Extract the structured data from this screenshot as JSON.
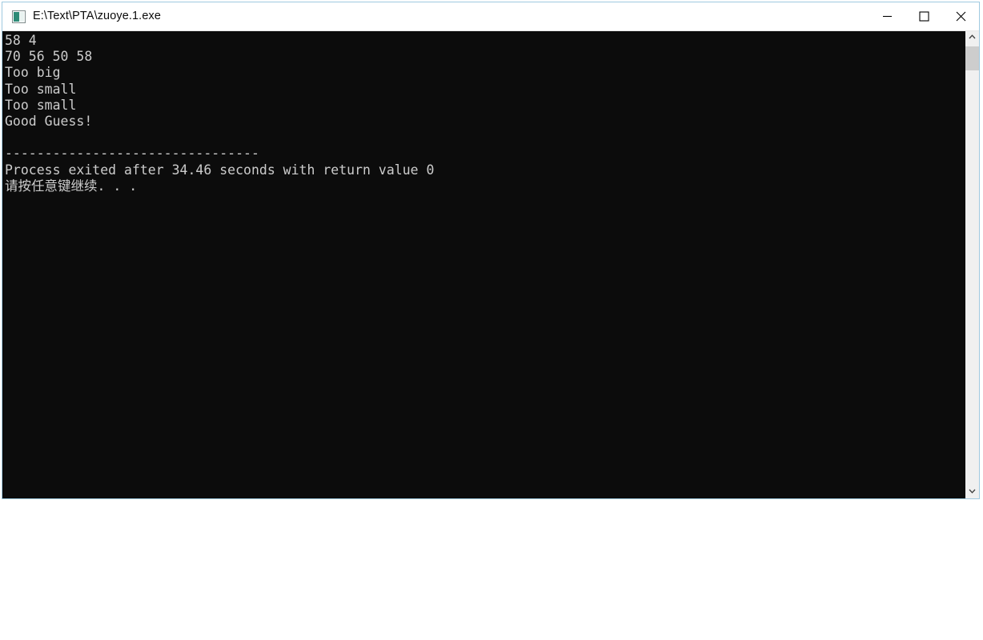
{
  "window": {
    "title": "E:\\Text\\PTA\\zuoye.1.exe",
    "icon": "console-app-icon",
    "border_color": "#9fc9e0",
    "titlebar_bg": "#ffffff",
    "titlebar_fg": "#0b0b0b"
  },
  "titlebar_buttons": {
    "minimize": "Minimize",
    "maximize": "Maximize",
    "close": "Close"
  },
  "console": {
    "background": "#0c0c0c",
    "foreground": "#cccccc",
    "lines": [
      "58 4",
      "70 56 50 58",
      "Too big",
      "Too small",
      "Too small",
      "Good Guess!",
      "",
      "--------------------------------",
      "Process exited after 34.46 seconds with return value 0",
      "请按任意键继续. . ."
    ],
    "text": "58 4\n70 56 50 58\nToo big\nToo small\nToo small\nGood Guess!\n\n--------------------------------\nProcess exited after 34.46 seconds with return value 0\n请按任意键继续. . .",
    "program_output": {
      "input_echo_line1": "58 4",
      "input_echo_line2": "70 56 50 58",
      "guess_results": [
        "Too big",
        "Too small",
        "Too small",
        "Good Guess!"
      ],
      "separator": "--------------------------------",
      "exit_message": "Process exited after 34.46 seconds with return value 0",
      "exit_seconds": "34.46",
      "return_value": "0",
      "press_any_key": "请按任意键继续. . ."
    }
  },
  "scrollbar": {
    "up_arrow": "scroll-up",
    "down_arrow": "scroll-down",
    "thumb": "scroll-thumb"
  }
}
